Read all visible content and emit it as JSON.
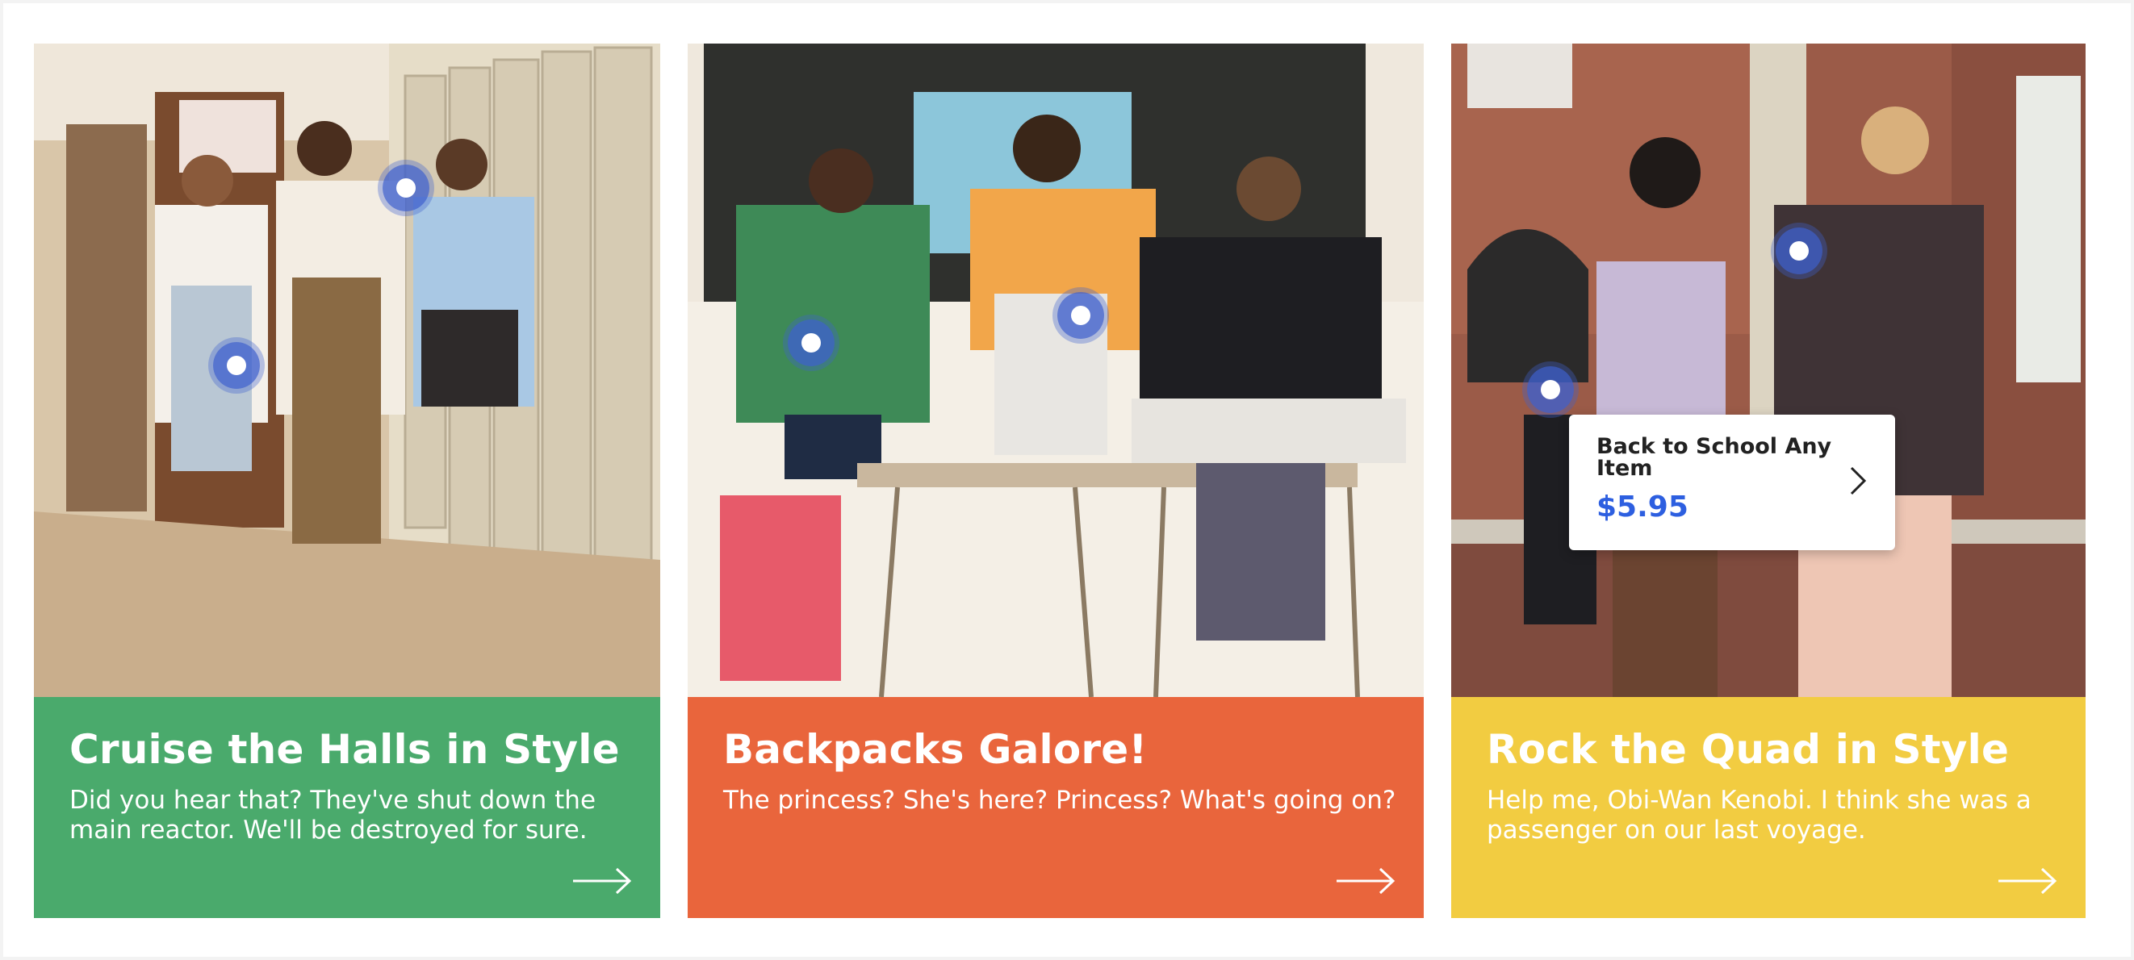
{
  "colors": {
    "card_green": "#4aaa6c",
    "card_orange": "#e9653c",
    "card_yellow": "#f2cc41",
    "hotspot_blue": "#3f60cd",
    "price_blue": "#2d5fe0"
  },
  "cards": [
    {
      "title": "Cruise the Halls in Style",
      "text": "Did you hear that? They've shut down the main reactor. We'll be destroyed for sure.",
      "arrow_icon": "arrow-right-icon"
    },
    {
      "title": "Backpacks Galore!",
      "text": "The princess? She's here? Princess? What's going on?",
      "arrow_icon": "arrow-right-icon"
    },
    {
      "title": "Rock the Quad in Style",
      "text": "Help me, Obi-Wan Kenobi. I think she was a passenger on our last voyage.",
      "arrow_icon": "arrow-right-icon",
      "tooltip": {
        "name": "Back to School Any Item",
        "price": "$5.95",
        "chevron_icon": "chevron-right-icon"
      }
    }
  ]
}
